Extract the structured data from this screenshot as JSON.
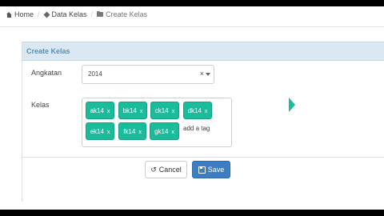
{
  "breadcrumb": {
    "items": [
      {
        "label": "Home",
        "icon": "home-icon"
      },
      {
        "label": "Data Kelas",
        "icon": "cube-icon"
      },
      {
        "label": "Create Kelas",
        "icon": "folder-icon"
      }
    ],
    "separator": "/"
  },
  "panel": {
    "title": "Create Kelas"
  },
  "form": {
    "angkatan": {
      "label": "Angkatan",
      "value": "2014",
      "clear": "×"
    },
    "kelas": {
      "label": "Kelas",
      "tags": [
        "ak14",
        "bk14",
        "ck14",
        "dk14",
        "ek14",
        "fk14",
        "gk14"
      ],
      "remove_glyph": "x",
      "placeholder": "add a tag"
    }
  },
  "buttons": {
    "cancel": "Cancel",
    "save": "Save"
  },
  "colors": {
    "tag": "#1abc9c",
    "panel_heading": "#d9e8f2",
    "primary": "#3c7dc4"
  }
}
